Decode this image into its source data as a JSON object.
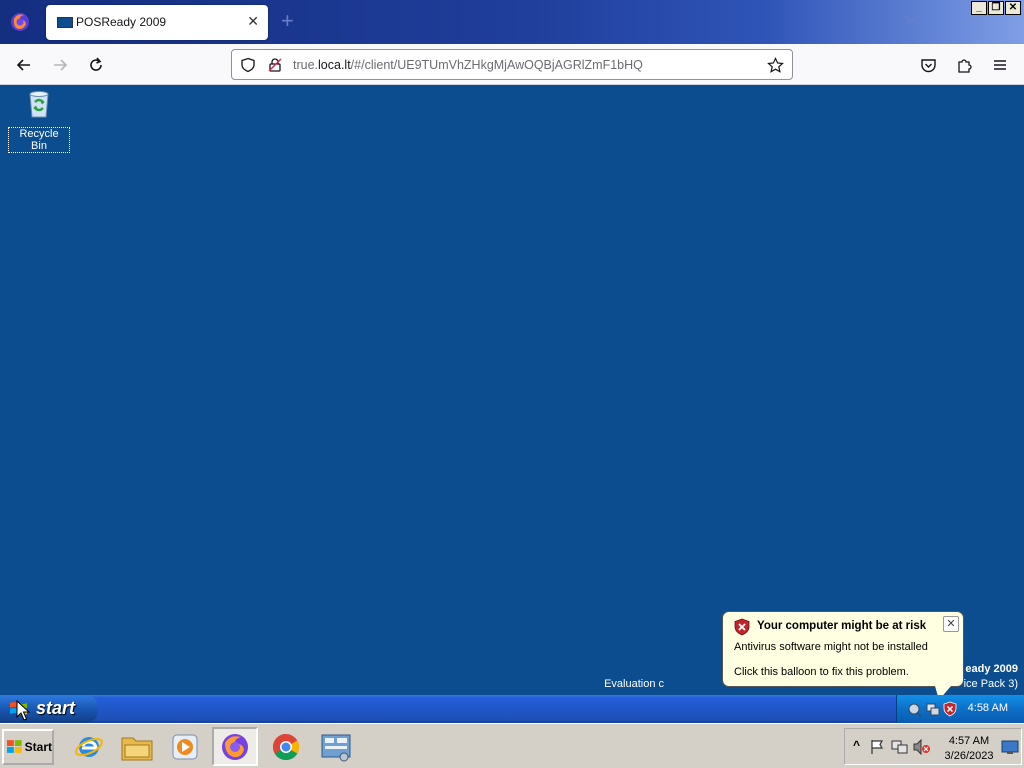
{
  "browser": {
    "tab_title": "POSReady 2009",
    "tab_close": "✕",
    "new_tab": "+",
    "url_prefix": "true.",
    "url_domain": "loca.lt",
    "url_path": "/#/client/UE9TUmVhZHkgMjAwOQBjAGRlZmF1bHQ",
    "window_buttons": [
      "_",
      "❐",
      "✕"
    ]
  },
  "desktop": {
    "recycle_bin_label": "Recycle Bin",
    "watermark_line1": "eady 2009",
    "watermark_line2": "Evaluation c",
    "watermark_line2_right": "ice Pack 3)"
  },
  "balloon": {
    "title": "Your computer might be at risk",
    "line1": "Antivirus software might not be installed",
    "line2": "Click this balloon to fix this problem.",
    "close": "✕"
  },
  "xp_taskbar": {
    "start_label": "start",
    "clock": "4:58 AM"
  },
  "host_taskbar": {
    "start_label": "Start",
    "clock_time": "4:57 AM",
    "clock_date": "3/26/2023",
    "tray_expand": "^"
  },
  "colors": {
    "desktop": "#0b4d8e",
    "xp_taskbar": "#245edb",
    "balloon": "#ffffe1",
    "host_taskbar": "#d4d0c8"
  }
}
